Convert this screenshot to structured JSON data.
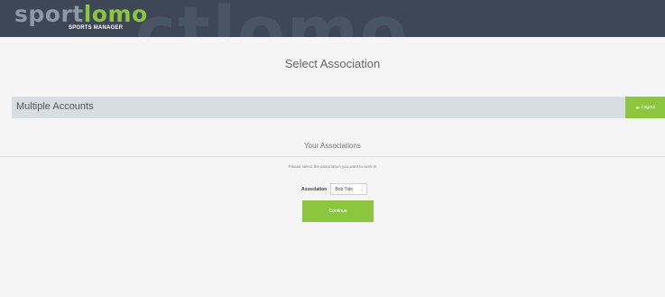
{
  "brand": {
    "logo_part1": "sport",
    "logo_part2": "lomo",
    "logo_sub": "SPORTS MANAGER",
    "watermark": "ctlomo"
  },
  "page": {
    "title": "Select Association"
  },
  "accounts_bar": {
    "label": "Multiple Accounts",
    "logout_label": "Logout",
    "logout_icon": "logout-arrow-icon"
  },
  "associations": {
    "section_title": "Your Associations",
    "help_text": "Please select the association you want to work in",
    "field_label": "Association",
    "selected_value": "Bob Tide",
    "continue_label": "Continue"
  },
  "colors": {
    "topbar": "#3d4755",
    "accent_green": "#8cc63f",
    "bar_gray": "#d8dde3",
    "background": "#f5f5f5"
  }
}
